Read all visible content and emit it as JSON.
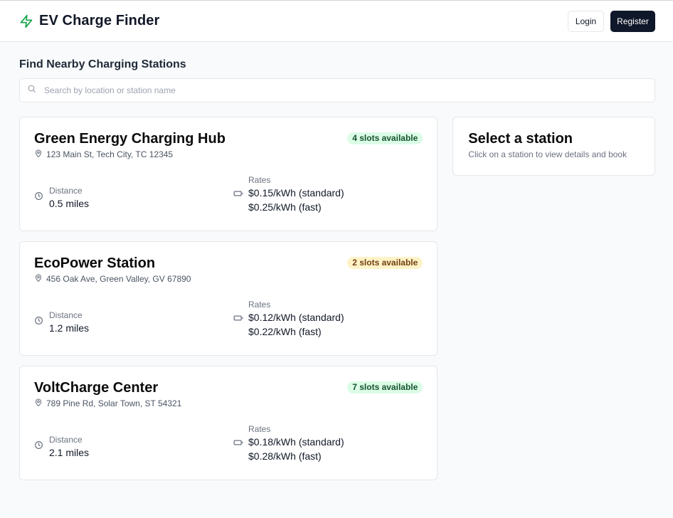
{
  "app": {
    "title": "EV Charge Finder",
    "accent_color": "#16a34a",
    "logo_icon": "lightning-bolt-icon"
  },
  "auth": {
    "login_label": "Login",
    "register_label": "Register"
  },
  "page": {
    "title": "Find Nearby Charging Stations"
  },
  "search": {
    "placeholder": "Search by location or station name",
    "value": ""
  },
  "stations": [
    {
      "name": "Green Energy Charging Hub",
      "address": "123 Main St, Tech City, TC 12345",
      "slots": "4 slots available",
      "slots_color": "green",
      "distance_label": "Distance",
      "distance": "0.5 miles",
      "rates_label": "Rates",
      "rate_standard": "$0.15/kWh (standard)",
      "rate_fast": "$0.25/kWh (fast)"
    },
    {
      "name": "EcoPower Station",
      "address": "456 Oak Ave, Green Valley, GV 67890",
      "slots": "2 slots available",
      "slots_color": "yellow",
      "distance_label": "Distance",
      "distance": "1.2 miles",
      "rates_label": "Rates",
      "rate_standard": "$0.12/kWh (standard)",
      "rate_fast": "$0.22/kWh (fast)"
    },
    {
      "name": "VoltCharge Center",
      "address": "789 Pine Rd, Solar Town, ST 54321",
      "slots": "7 slots available",
      "slots_color": "green",
      "distance_label": "Distance",
      "distance": "2.1 miles",
      "rates_label": "Rates",
      "rate_standard": "$0.18/kWh (standard)",
      "rate_fast": "$0.28/kWh (fast)"
    }
  ],
  "detail": {
    "title": "Select a station",
    "subtitle": "Click on a station to view details and book"
  }
}
